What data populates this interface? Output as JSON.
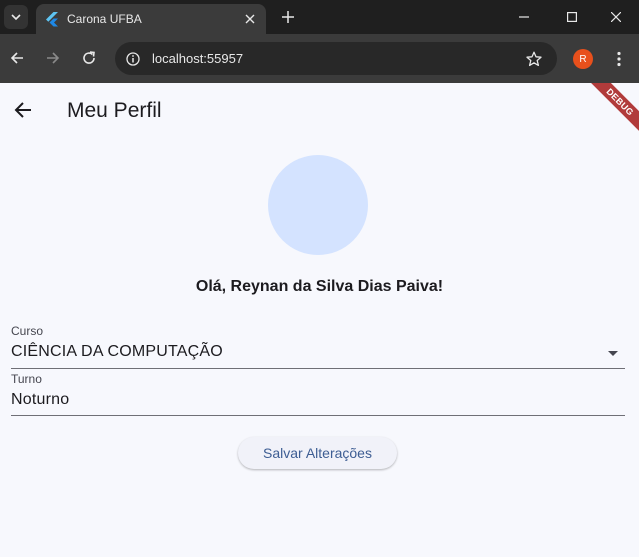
{
  "browser": {
    "tab_title": "Carona UFBA",
    "url": "localhost:55957",
    "profile_initial": "R"
  },
  "app": {
    "page_title": "Meu Perfil",
    "debug_banner": "DEBUG",
    "greeting": "Olá, Reynan da Silva Dias Paiva!",
    "curso": {
      "label": "Curso",
      "value": "CIÊNCIA DA COMPUTAÇÃO"
    },
    "turno": {
      "label": "Turno",
      "value": "Noturno"
    },
    "save_label": "Salvar Alterações"
  },
  "colors": {
    "background": "#f7f8fd",
    "avatar": "#d4e3ff",
    "button_text": "#3d5d93",
    "debug_banner": "#b13b3b",
    "profile_badge": "#e8501c"
  },
  "icons": [
    "tab-search-icon",
    "flutter-icon",
    "close-icon",
    "plus-icon",
    "minimize-icon",
    "maximize-icon",
    "window-close-icon",
    "back-icon",
    "forward-icon",
    "reload-icon",
    "info-icon",
    "star-icon",
    "kebab-menu-icon",
    "arrow-left-icon",
    "dropdown-arrow-icon"
  ]
}
